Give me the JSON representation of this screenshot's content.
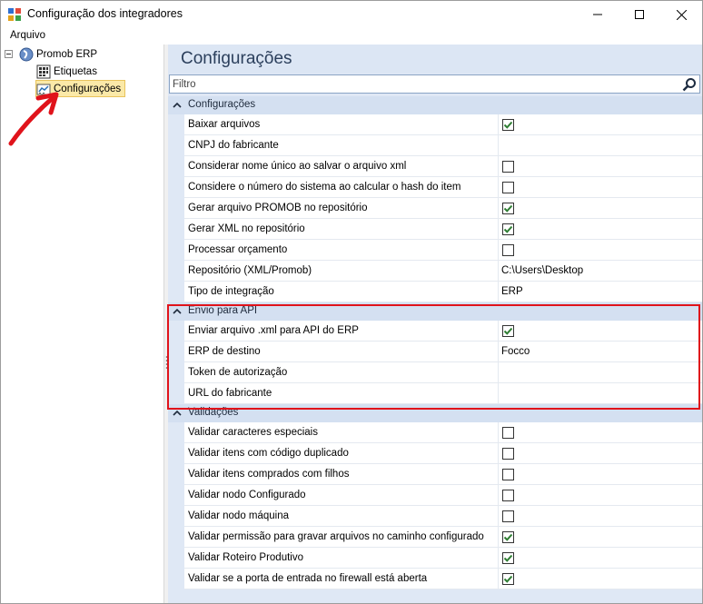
{
  "window": {
    "title": "Configuração dos integradores",
    "menu": [
      "Arquivo"
    ]
  },
  "tree": {
    "root": {
      "label": "Promob ERP"
    },
    "children": [
      {
        "label": "Etiquetas",
        "selected": false
      },
      {
        "label": "Configurações",
        "selected": true
      }
    ]
  },
  "panel": {
    "title": "Configurações",
    "filter_placeholder": "Filtro"
  },
  "categories": [
    {
      "name": "Configurações",
      "properties": [
        {
          "name": "Baixar arquivos",
          "type": "bool",
          "checked": true
        },
        {
          "name": "CNPJ do fabricante",
          "type": "text",
          "value": ""
        },
        {
          "name": "Considerar nome único ao salvar o arquivo xml",
          "type": "bool",
          "checked": false
        },
        {
          "name": "Considere o número do sistema ao calcular o hash do item",
          "type": "bool",
          "checked": false
        },
        {
          "name": "Gerar arquivo PROMOB no repositório",
          "type": "bool",
          "checked": true
        },
        {
          "name": "Gerar XML no repositório",
          "type": "bool",
          "checked": true
        },
        {
          "name": "Processar orçamento",
          "type": "bool",
          "checked": false
        },
        {
          "name": "Repositório (XML/Promob)",
          "type": "text",
          "value": "C:\\Users\\Desktop"
        },
        {
          "name": "Tipo de integração",
          "type": "text",
          "value": "ERP"
        }
      ]
    },
    {
      "name": "Envio para API",
      "properties": [
        {
          "name": "Enviar arquivo .xml para API do ERP",
          "type": "bool",
          "checked": true
        },
        {
          "name": "ERP de destino",
          "type": "text",
          "value": "Focco"
        },
        {
          "name": "Token de autorização",
          "type": "text",
          "value": ""
        },
        {
          "name": "URL do fabricante",
          "type": "text",
          "value": ""
        }
      ]
    },
    {
      "name": "Validações",
      "properties": [
        {
          "name": "Validar caracteres especiais",
          "type": "bool",
          "checked": false
        },
        {
          "name": "Validar itens com código duplicado",
          "type": "bool",
          "checked": false
        },
        {
          "name": "Validar itens comprados com filhos",
          "type": "bool",
          "checked": false
        },
        {
          "name": "Validar nodo Configurado",
          "type": "bool",
          "checked": false
        },
        {
          "name": "Validar nodo máquina",
          "type": "bool",
          "checked": false
        },
        {
          "name": "Validar permissão para gravar arquivos no caminho configurado",
          "type": "bool",
          "checked": true
        },
        {
          "name": "Validar Roteiro Produtivo",
          "type": "bool",
          "checked": true
        },
        {
          "name": "Validar se a porta de entrada no firewall está aberta",
          "type": "bool",
          "checked": true
        }
      ]
    }
  ],
  "colors": {
    "check": "#2e7d32",
    "highlight": "#e0131b",
    "selection": "#fbe9a8"
  }
}
